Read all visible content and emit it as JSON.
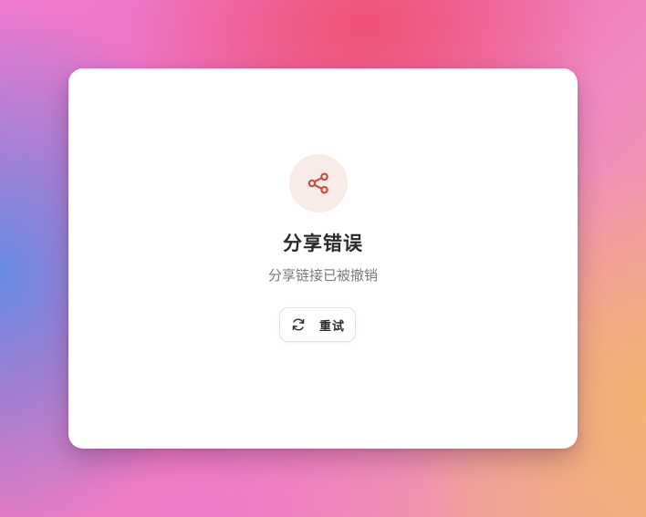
{
  "error_card": {
    "icon": "share-icon",
    "accent_color": "#c0533e",
    "icon_bg_color": "#f9ebe8",
    "title": "分享错误",
    "message": "分享链接已被撤销",
    "retry_button": {
      "icon": "refresh-icon",
      "label": "重试"
    }
  }
}
